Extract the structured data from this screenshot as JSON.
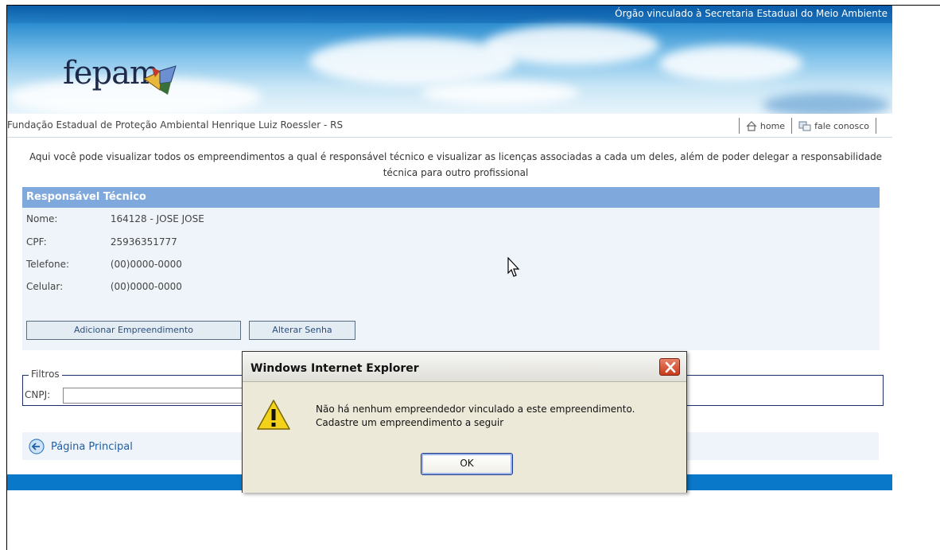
{
  "banner": {
    "tagline": "Órgão vinculado à Secretaria Estadual do Meio Ambiente",
    "logo_text": "fepam"
  },
  "subheader": {
    "org_name": "Fundação Estadual de Proteção Ambiental Henrique Luiz Roessler - RS",
    "nav": {
      "home": "home",
      "contact": "fale conosco"
    }
  },
  "intro": "Aqui você pode visualizar todos os empreendimentos a qual é responsável técnico e visualizar as licenças associadas a cada um deles, além de poder delegar a responsabilidade técnica para outro profissional",
  "panel": {
    "title": "Responsável Técnico",
    "fields": [
      {
        "label": "Nome:",
        "value": "164128 - JOSE JOSE"
      },
      {
        "label": "CPF:",
        "value": "25936351777"
      },
      {
        "label": "Telefone:",
        "value": "(00)0000-0000"
      },
      {
        "label": "Celular:",
        "value": "(00)0000-0000"
      }
    ],
    "buttons": {
      "add": "Adicionar Empreendimento",
      "password": "Alterar Senha"
    }
  },
  "filters": {
    "legend": "Filtros",
    "cnpj_label": "CNPJ:",
    "cnpj_value": ""
  },
  "back_link": "Página Principal",
  "dialog": {
    "title": "Windows Internet Explorer",
    "message_line1": "Não há nenhum empreendedor vinculado a este empreendimento.",
    "message_line2": "Cadastre um empreendimento a seguir",
    "ok_label": "OK",
    "icon": "warning-icon"
  },
  "colors": {
    "panel_header": "#7fa8dc",
    "footer_bar": "#0a78c8",
    "panel_bg": "#eef4f9"
  }
}
